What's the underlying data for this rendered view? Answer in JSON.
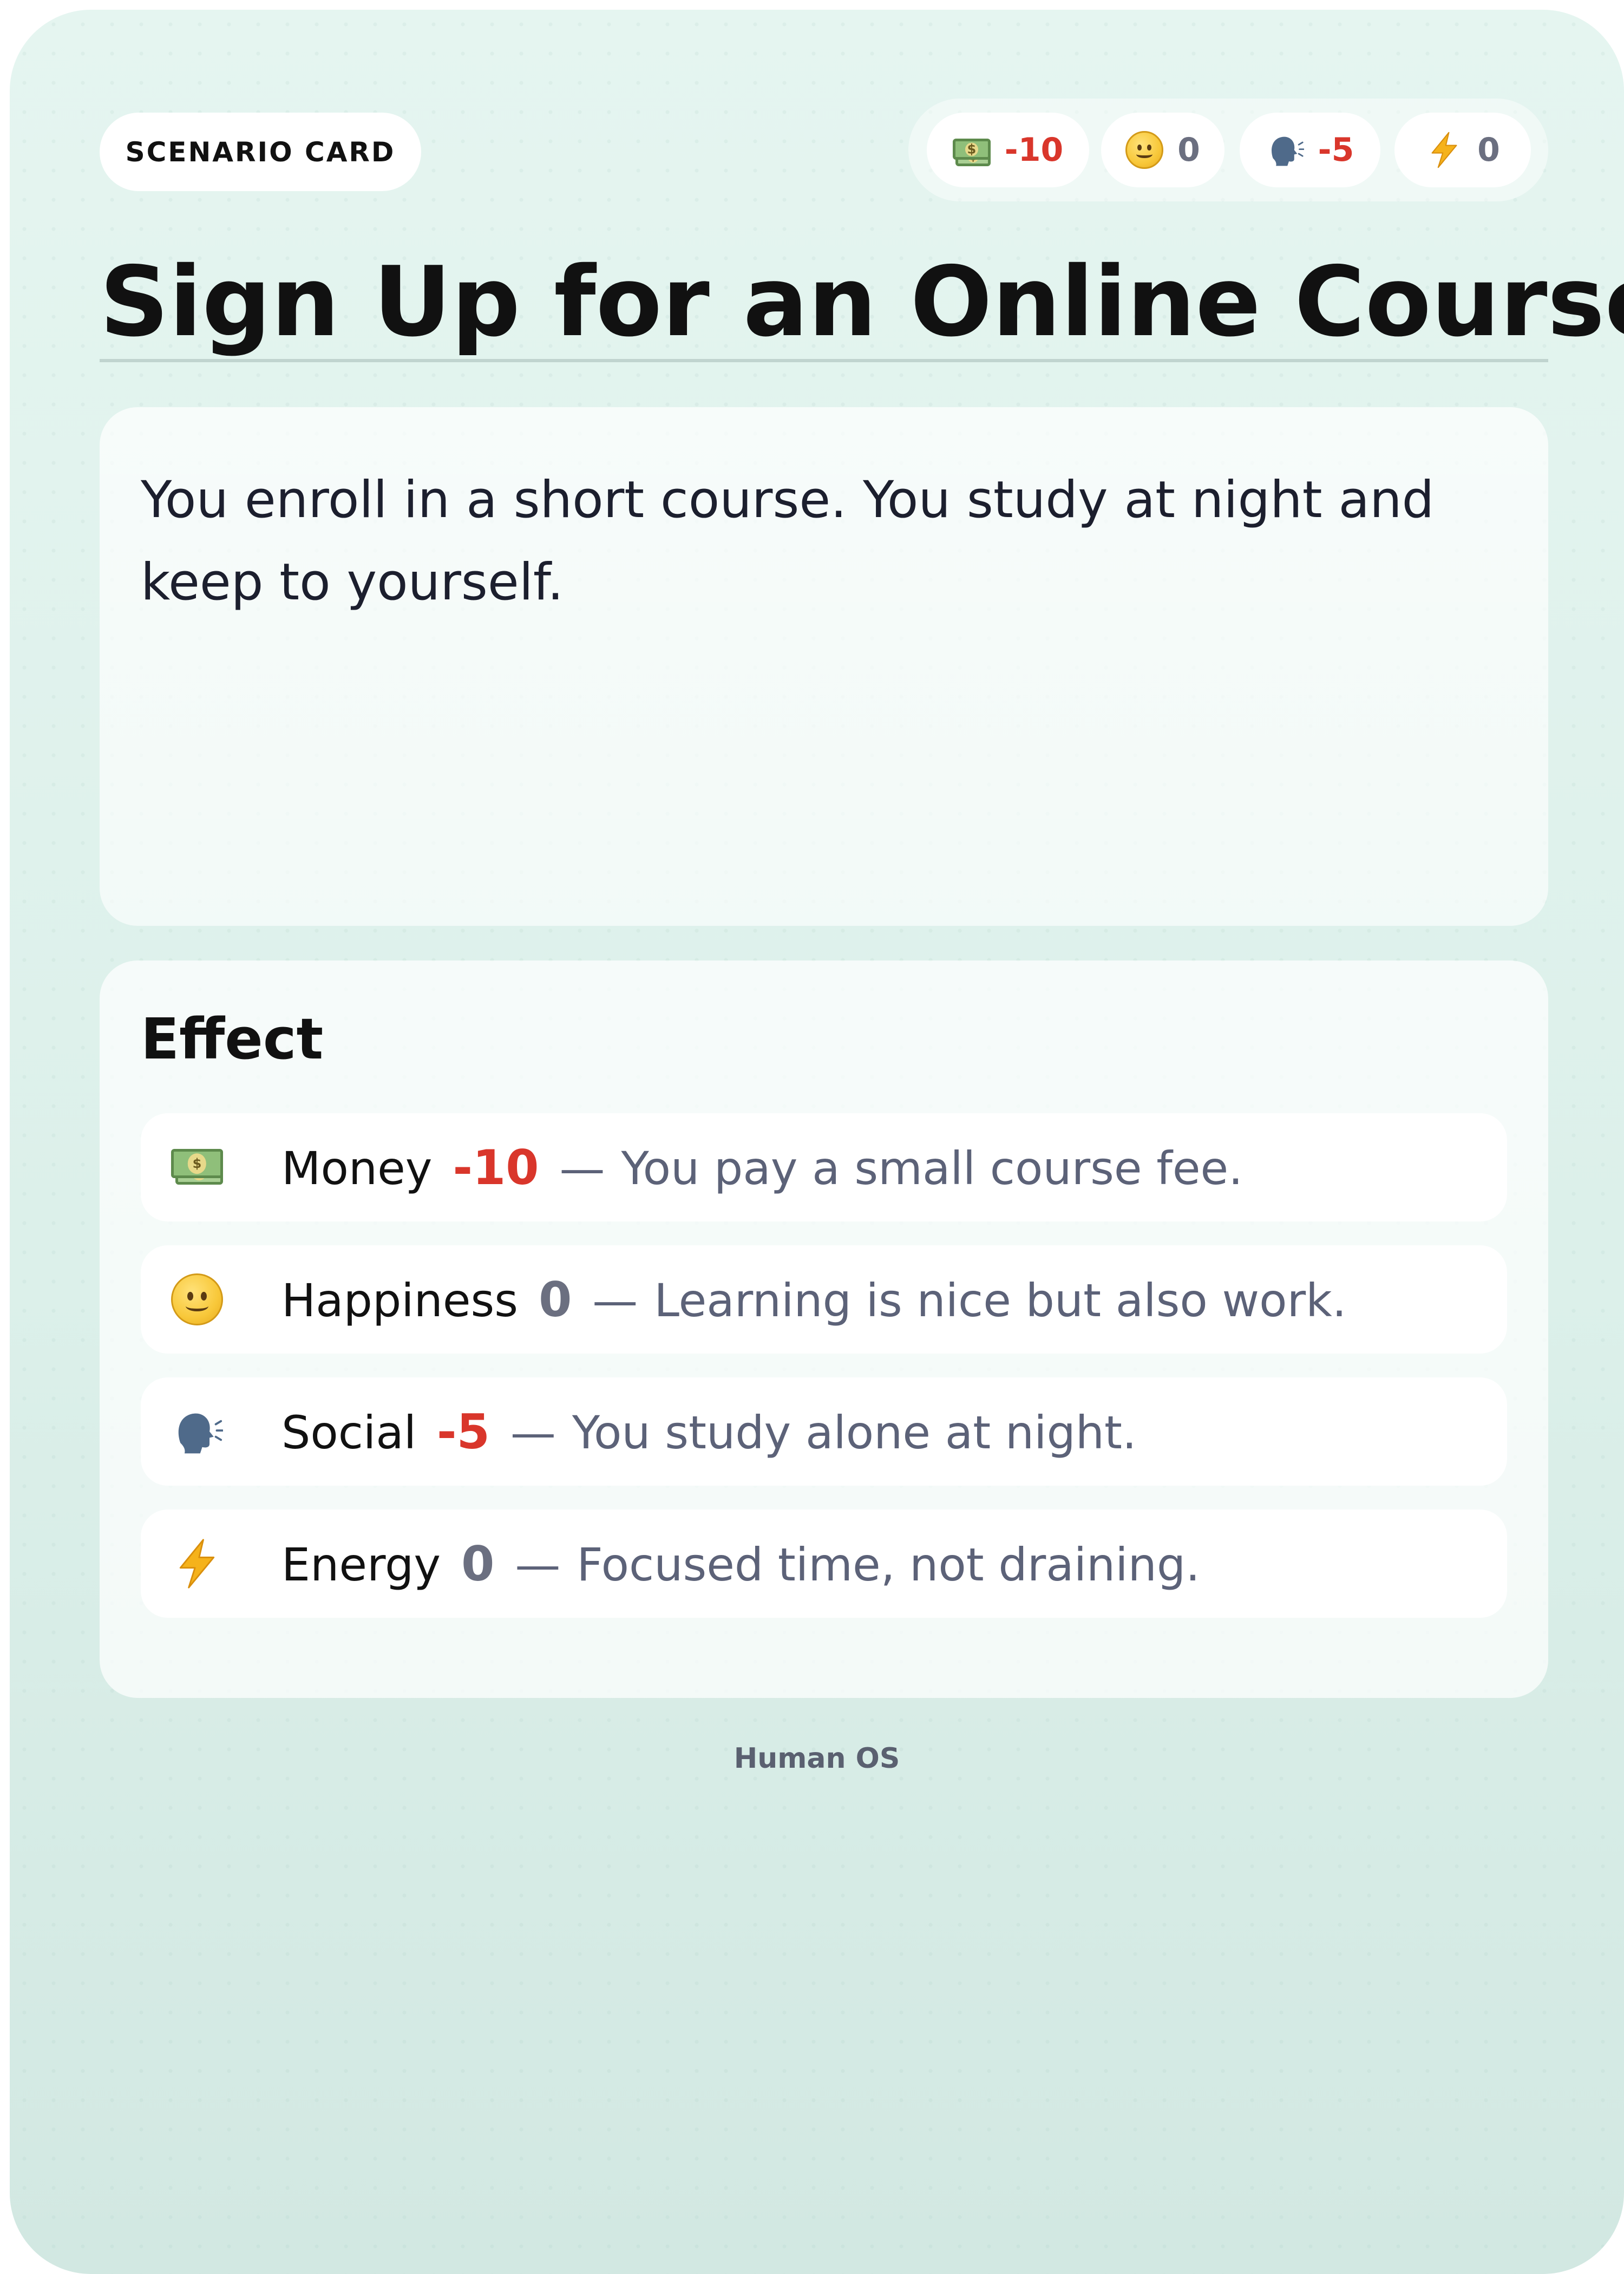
{
  "card": {
    "tag": "SCENARIO CARD",
    "title": "Sign Up for an Online Course",
    "description": "You enroll in a short course. You study at night and keep to yourself.",
    "footer": "Human OS"
  },
  "stats": [
    {
      "name": "money",
      "icon": "money-icon",
      "value": "-10",
      "tone": "negative"
    },
    {
      "name": "happiness",
      "icon": "smiley-icon",
      "value": "0",
      "tone": "neutral"
    },
    {
      "name": "social",
      "icon": "speaking-head-icon",
      "value": "-5",
      "tone": "negative"
    },
    {
      "name": "energy",
      "icon": "lightning-icon",
      "value": "0",
      "tone": "neutral"
    }
  ],
  "effect": {
    "heading": "Effect",
    "rows": [
      {
        "icon": "money-icon",
        "label": "Money",
        "value": "-10",
        "dash": "—",
        "description": "You pay a small course fee."
      },
      {
        "icon": "smiley-icon",
        "label": "Happiness",
        "value": "0",
        "dash": "—",
        "description": "Learning is nice but also work."
      },
      {
        "icon": "speaking-head-icon",
        "label": "Social",
        "value": "-5",
        "dash": "—",
        "description": "You study alone at night."
      },
      {
        "icon": "lightning-icon",
        "label": "Energy",
        "value": "0",
        "dash": "—",
        "description": "Focused time, not draining."
      }
    ]
  },
  "colors": {
    "negative": "#d9362b",
    "neutral": "#6b6f80",
    "description_text": "#5c6278",
    "lightning": "#f5b21b",
    "speaking_head": "#4f6a8a"
  }
}
